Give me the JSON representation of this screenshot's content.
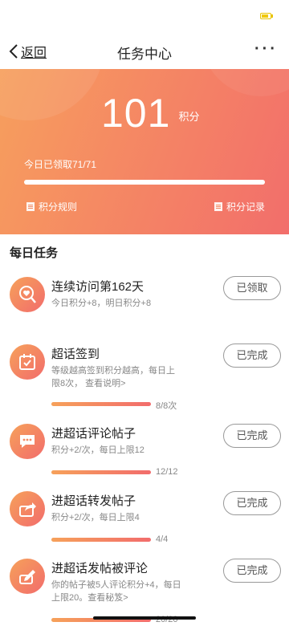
{
  "colors": {
    "accent": "#f26c6c",
    "accent_start": "#f6a15a"
  },
  "nav": {
    "back_label": "返回",
    "title": "任务中心",
    "more": "···"
  },
  "summary": {
    "points": "101",
    "points_unit": "积分",
    "claimed_text": "今日已领取71/71",
    "progress_fraction": 1.0,
    "rules_label": "积分规则",
    "records_label": "积分记录"
  },
  "daily": {
    "title": "每日任务",
    "tasks": [
      {
        "title": "连续访问第162天",
        "desc": "今日积分+8，明日积分+8",
        "button": "已领取",
        "icon": "heart-search-icon"
      },
      {
        "title": "超话签到",
        "desc": "等级越高签到积分越高，每日上限8次，  查看说明>",
        "button": "已完成",
        "count": "8/8次",
        "progress_fraction": 1.0,
        "icon": "calendar-check-icon"
      },
      {
        "title": "进超话评论帖子",
        "desc": "积分+2/次，每日上限12",
        "button": "已完成",
        "count": "12/12",
        "progress_fraction": 1.0,
        "icon": "comment-icon"
      },
      {
        "title": "进超话转发帖子",
        "desc": "积分+2/次，每日上限4",
        "button": "已完成",
        "count": "4/4",
        "progress_fraction": 1.0,
        "icon": "share-icon"
      },
      {
        "title": "进超话发帖被评论",
        "desc": "你的帖子被5人评论积分+4，每日上限20。查看秘笈>",
        "button": "已完成",
        "count": "20/20",
        "progress_fraction": 1.0,
        "icon": "edit-post-icon"
      }
    ]
  }
}
